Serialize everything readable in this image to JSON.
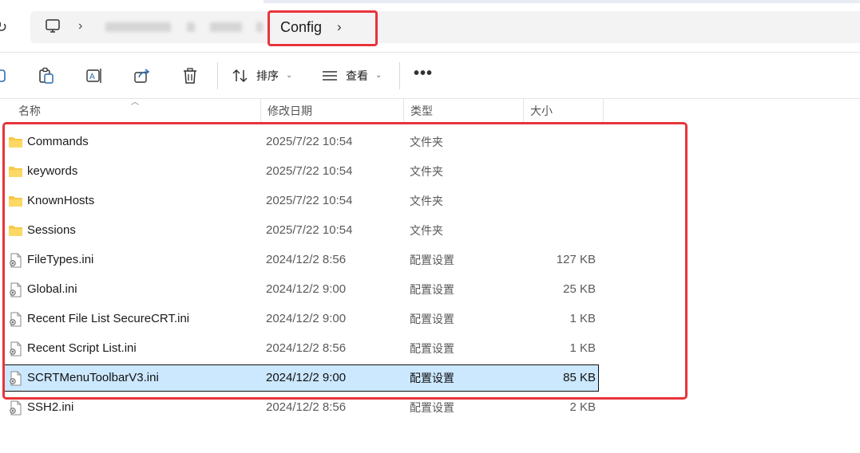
{
  "address": {
    "current": "Config",
    "chevron": "›"
  },
  "toolbar": {
    "sort_label": "排序",
    "view_label": "查看",
    "more_label": "•••",
    "caret": "⌄"
  },
  "columns": {
    "name": "名称",
    "date": "修改日期",
    "type": "类型",
    "size": "大小"
  },
  "files": [
    {
      "name": "Commands",
      "date": "2025/7/22 10:54",
      "type": "文件夹",
      "size": "",
      "icon": "folder-icon"
    },
    {
      "name": "keywords",
      "date": "2025/7/22 10:54",
      "type": "文件夹",
      "size": "",
      "icon": "folder-icon"
    },
    {
      "name": "KnownHosts",
      "date": "2025/7/22 10:54",
      "type": "文件夹",
      "size": "",
      "icon": "folder-icon"
    },
    {
      "name": "Sessions",
      "date": "2025/7/22 10:54",
      "type": "文件夹",
      "size": "",
      "icon": "folder-icon"
    },
    {
      "name": "FileTypes.ini",
      "date": "2024/12/2 8:56",
      "type": "配置设置",
      "size": "127 KB",
      "icon": "ini-file-icon"
    },
    {
      "name": "Global.ini",
      "date": "2024/12/2 9:00",
      "type": "配置设置",
      "size": "25 KB",
      "icon": "ini-file-icon"
    },
    {
      "name": "Recent File List SecureCRT.ini",
      "date": "2024/12/2 9:00",
      "type": "配置设置",
      "size": "1 KB",
      "icon": "ini-file-icon"
    },
    {
      "name": "Recent Script List.ini",
      "date": "2024/12/2 8:56",
      "type": "配置设置",
      "size": "1 KB",
      "icon": "ini-file-icon"
    },
    {
      "name": "SCRTMenuToolbarV3.ini",
      "date": "2024/12/2 9:00",
      "type": "配置设置",
      "size": "85 KB",
      "icon": "ini-file-icon",
      "selected": true
    },
    {
      "name": "SSH2.ini",
      "date": "2024/12/2 8:56",
      "type": "配置设置",
      "size": "2 KB",
      "icon": "ini-file-icon"
    }
  ],
  "colors": {
    "highlight_red": "#e8343b",
    "selection_bg": "#cce8ff",
    "folder_yellow": "#f7c948"
  }
}
